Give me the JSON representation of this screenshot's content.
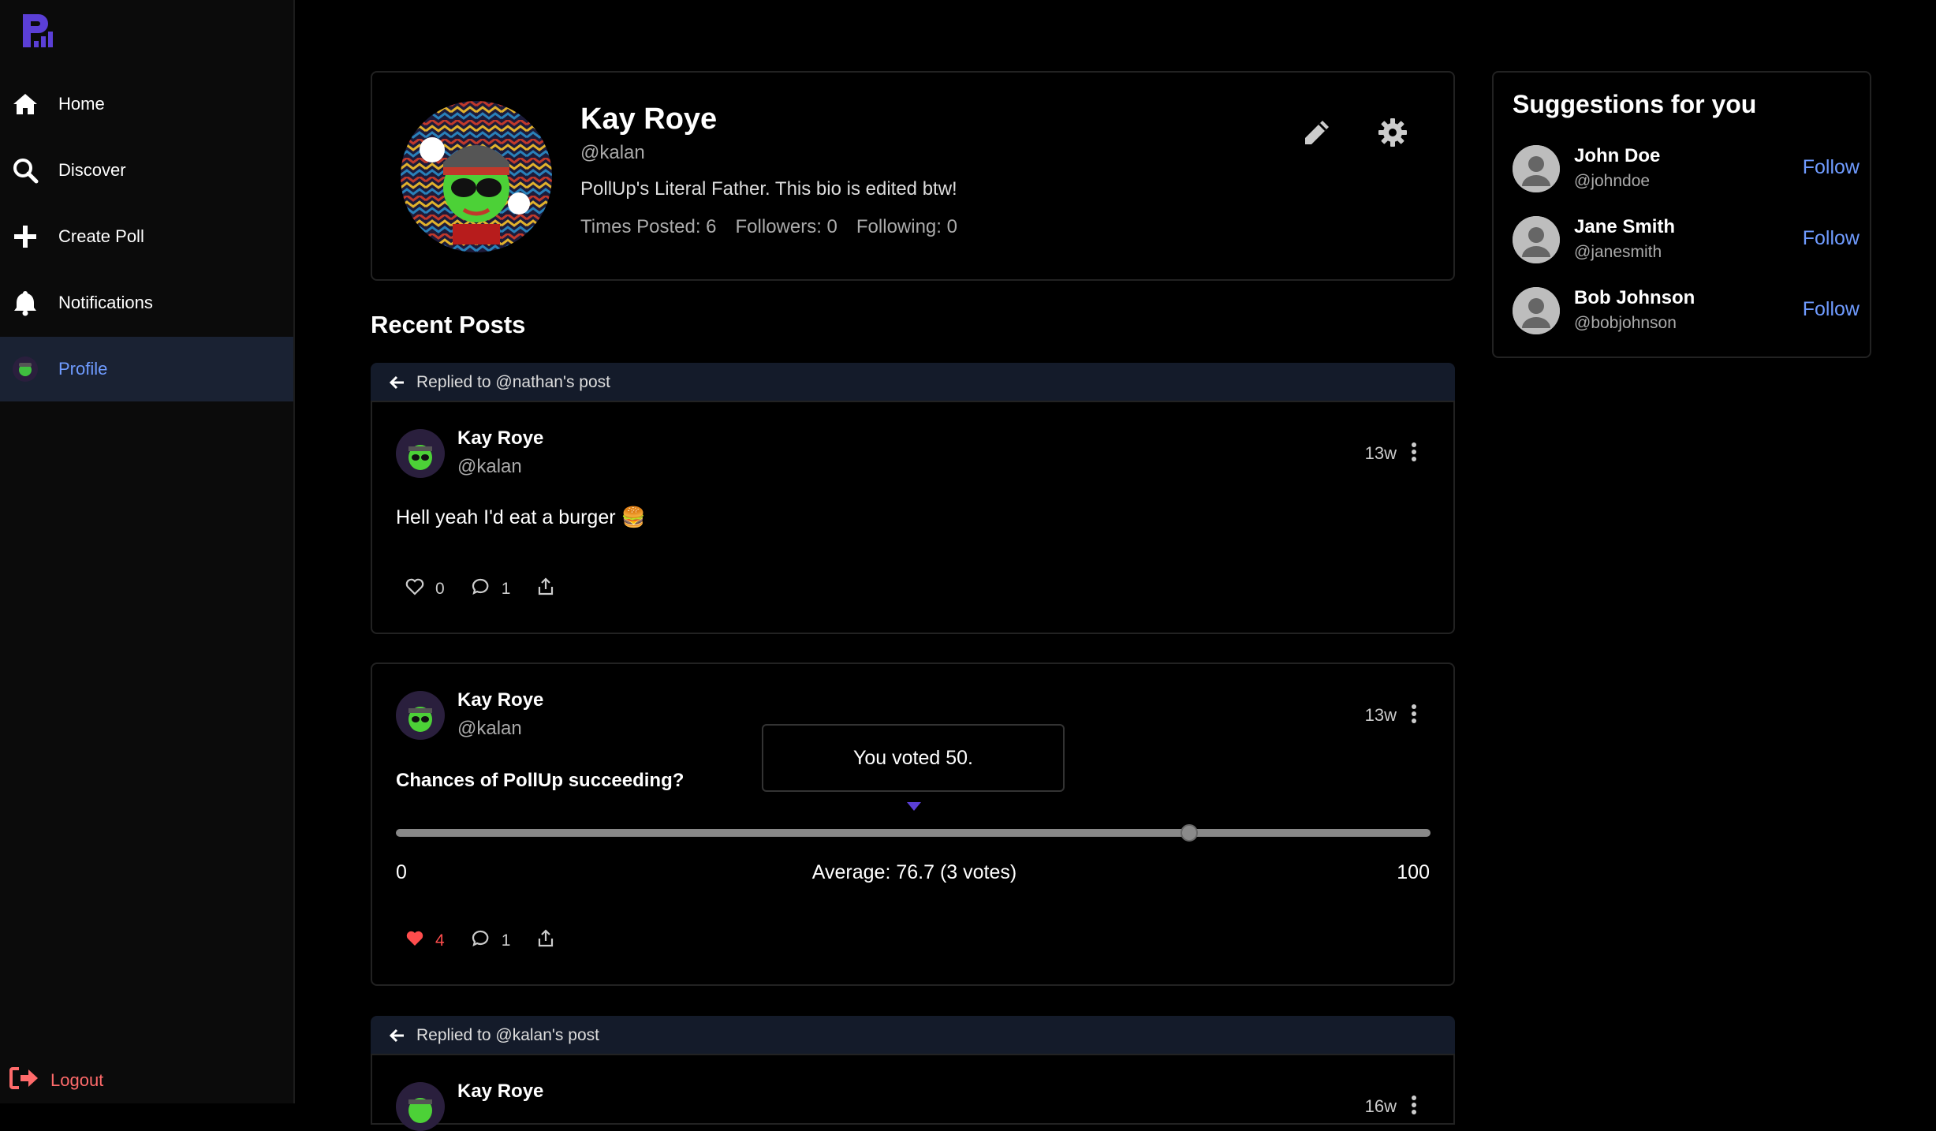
{
  "nav": {
    "items": [
      {
        "label": "Home",
        "icon": "home-icon"
      },
      {
        "label": "Discover",
        "icon": "search-icon"
      },
      {
        "label": "Create Poll",
        "icon": "plus-icon"
      },
      {
        "label": "Notifications",
        "icon": "bell-icon"
      },
      {
        "label": "Profile",
        "icon": "avatar",
        "active": true
      }
    ],
    "logout_label": "Logout"
  },
  "profile": {
    "name": "Kay Roye",
    "handle": "@kalan",
    "bio": "PollUp's Literal Father. This bio is edited btw!",
    "stats": {
      "posted": "Times Posted: 6",
      "followers": "Followers: 0",
      "following": "Following: 0"
    }
  },
  "recent_posts_title": "Recent Posts",
  "posts": [
    {
      "reply_to": "Replied to @nathan's post",
      "author": "Kay Roye",
      "handle": "@kalan",
      "time": "13w",
      "text": "Hell yeah I'd eat a burger 🍔",
      "likes": "0",
      "comments": "1"
    },
    {
      "author": "Kay Roye",
      "handle": "@kalan",
      "time": "13w",
      "question": "Chances of PollUp succeeding?",
      "tooltip": "You voted 50.",
      "min_label": "0",
      "max_label": "100",
      "average_label": "Average: 76.7 (3 votes)",
      "user_vote": 50,
      "average": 76.7,
      "likes": "4",
      "comments": "1",
      "liked": true
    },
    {
      "reply_to": "Replied to @kalan's post",
      "author": "Kay Roye",
      "time": "16w"
    }
  ],
  "suggestions": {
    "title": "Suggestions for you",
    "follow_label": "Follow",
    "users": [
      {
        "name": "John Doe",
        "handle": "@johndoe"
      },
      {
        "name": "Jane Smith",
        "handle": "@janesmith"
      },
      {
        "name": "Bob Johnson",
        "handle": "@bobjohnson"
      }
    ]
  },
  "colors": {
    "accent": "#6f9bff",
    "logo": "#5b3fd6",
    "like": "#ff4d4d",
    "logout": "#ff6b6b"
  }
}
